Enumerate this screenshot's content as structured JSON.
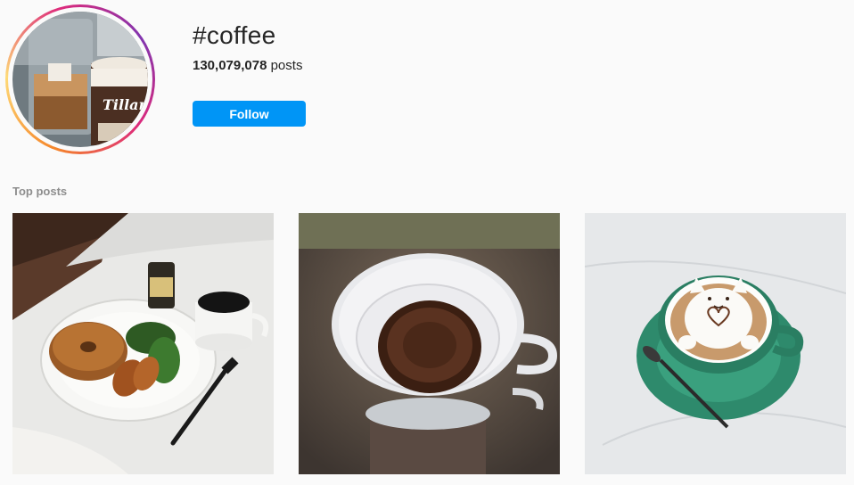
{
  "header": {
    "hashtag": "#coffee",
    "post_count": "130,079,078",
    "post_count_suffix": " posts",
    "follow_label": "Follow",
    "avatar_text": "Tillam"
  },
  "top_posts": {
    "title": "Top posts",
    "items": [
      {
        "description": "bagel-breakfast-with-coffee-cup"
      },
      {
        "description": "pour-over-coffee-filter"
      },
      {
        "description": "latte-art-cat-cup"
      }
    ]
  },
  "colors": {
    "accent": "#0095f6",
    "background": "#fafafa",
    "muted_text": "#8e8e8e"
  }
}
